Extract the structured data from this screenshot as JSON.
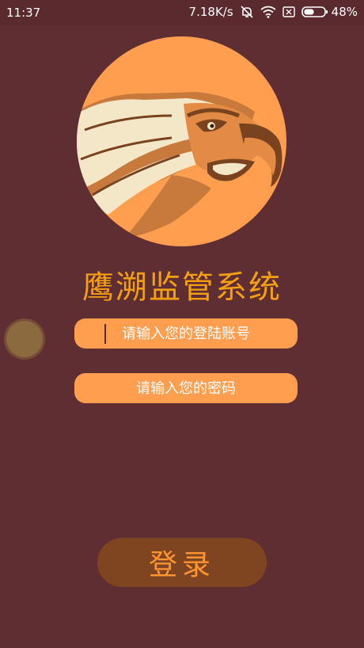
{
  "status_bar": {
    "time": "11:37",
    "network_speed": "7.18K/s",
    "battery_percent": "48%",
    "icons": [
      "mute-icon",
      "wifi-icon",
      "no-sim-icon",
      "battery-icon"
    ]
  },
  "logo": {
    "icon": "eagle-logo-icon",
    "circle_color": "#ff9e4f"
  },
  "title": "鹰溯监管系统",
  "form": {
    "account_placeholder": "请输入您的登陆账号",
    "password_placeholder": "请输入您的密码"
  },
  "login_button": {
    "label": "登录"
  },
  "colors": {
    "background": "#5e2e32",
    "accent": "#ff9e4f",
    "title": "#f5a012",
    "button": "#7e4520"
  }
}
